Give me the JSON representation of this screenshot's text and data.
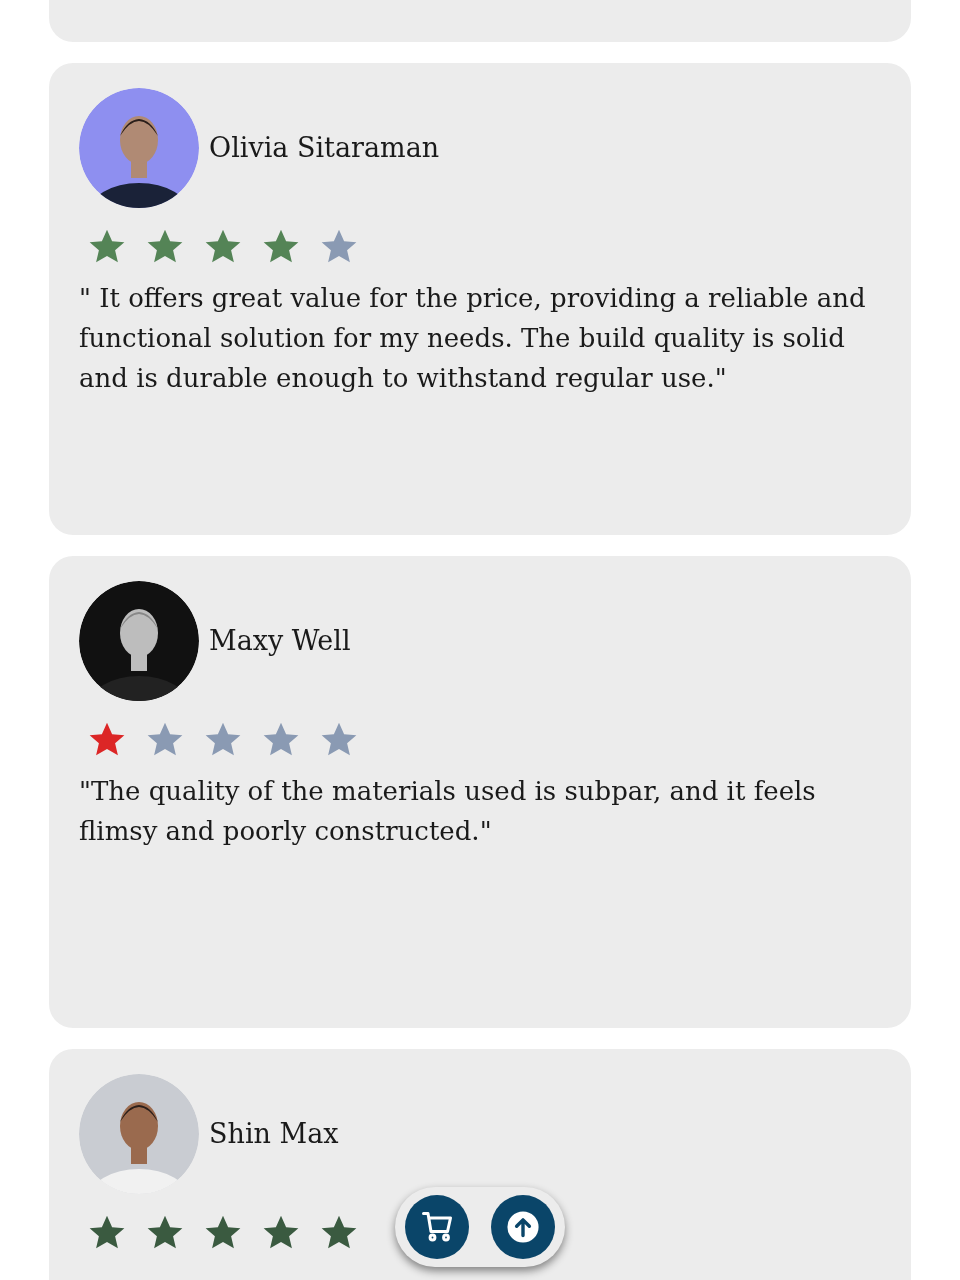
{
  "reviews": [
    {
      "name": "Olivia Sitaraman",
      "stars": 4,
      "color": "#548456",
      "text": "\" It offers great value for the price, providing a reliable and functional solution for my needs. The build quality is solid and is durable enough to withstand regular use.\""
    },
    {
      "name": "Maxy Well",
      "stars": 1,
      "color": "#dc2626",
      "text": "\"The quality of the materials used is subpar, and it feels flimsy and poorly constructed.\""
    },
    {
      "name": "Shin Max",
      "stars": 5,
      "color": "#3a5a40"
    }
  ]
}
